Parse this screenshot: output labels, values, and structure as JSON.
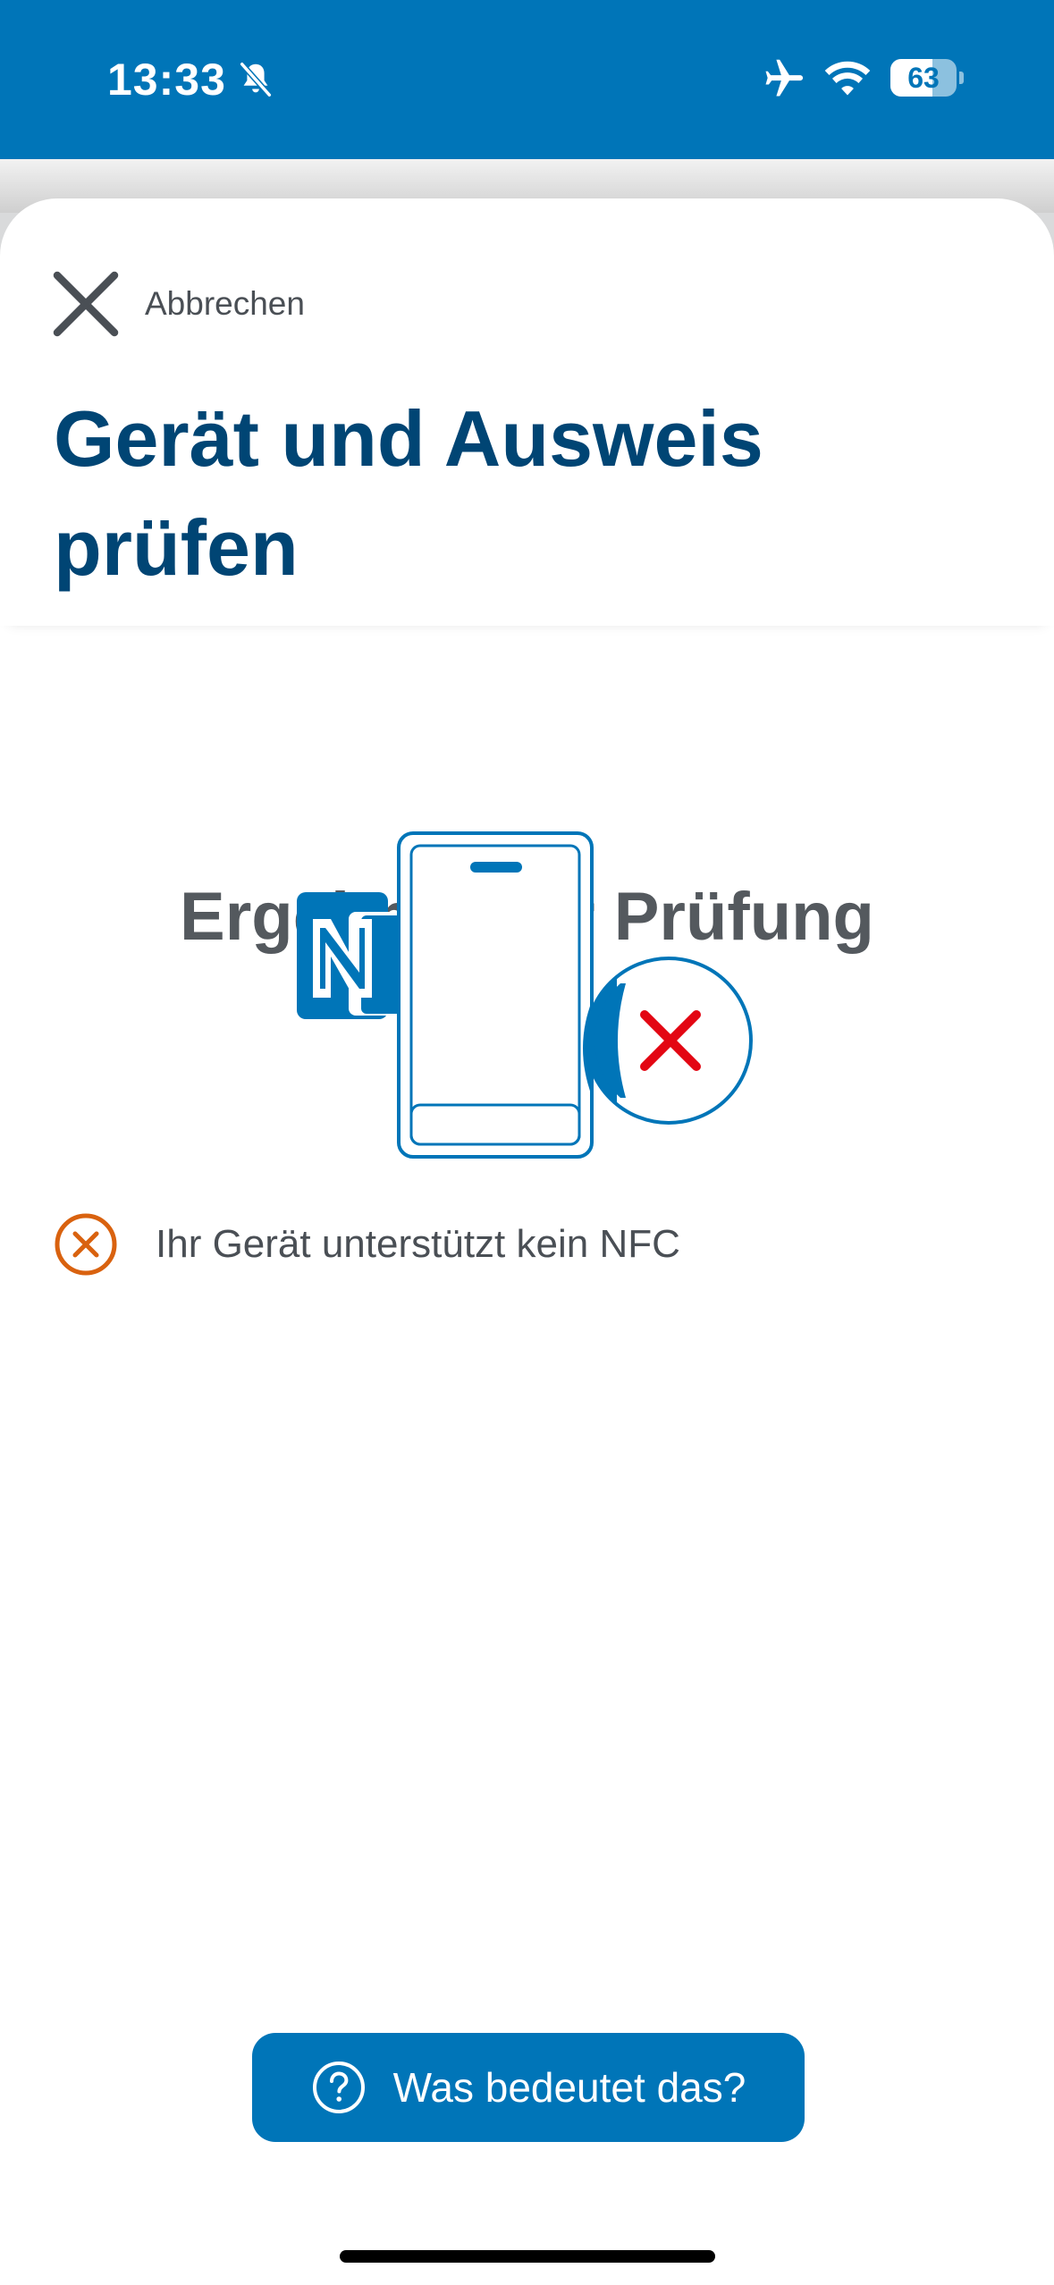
{
  "status_bar": {
    "time": "13:33",
    "battery_level": "63",
    "battery_fraction": 0.63,
    "icons": [
      "bell-slash-icon",
      "airplane-icon",
      "wifi-icon",
      "battery-icon"
    ]
  },
  "header": {
    "cancel_label": "Abbrechen",
    "title": "Gerät und Ausweis prüfen"
  },
  "main": {
    "heading": "Ergebnis der Prüfung",
    "illustration_icon": "phone-nfc-not-supported-icon",
    "result": {
      "icon": "error-circle-icon",
      "text": "Ihr Gerät unterstützt kein NFC"
    }
  },
  "help_button": {
    "label": "Was bedeutet das?",
    "icon": "question-circle-icon"
  },
  "colors": {
    "brand_blue": "#0075b8",
    "title_blue": "#004574",
    "text_gray": "#54595e",
    "error_red": "#e30613",
    "warning_orange": "#d9620f"
  }
}
